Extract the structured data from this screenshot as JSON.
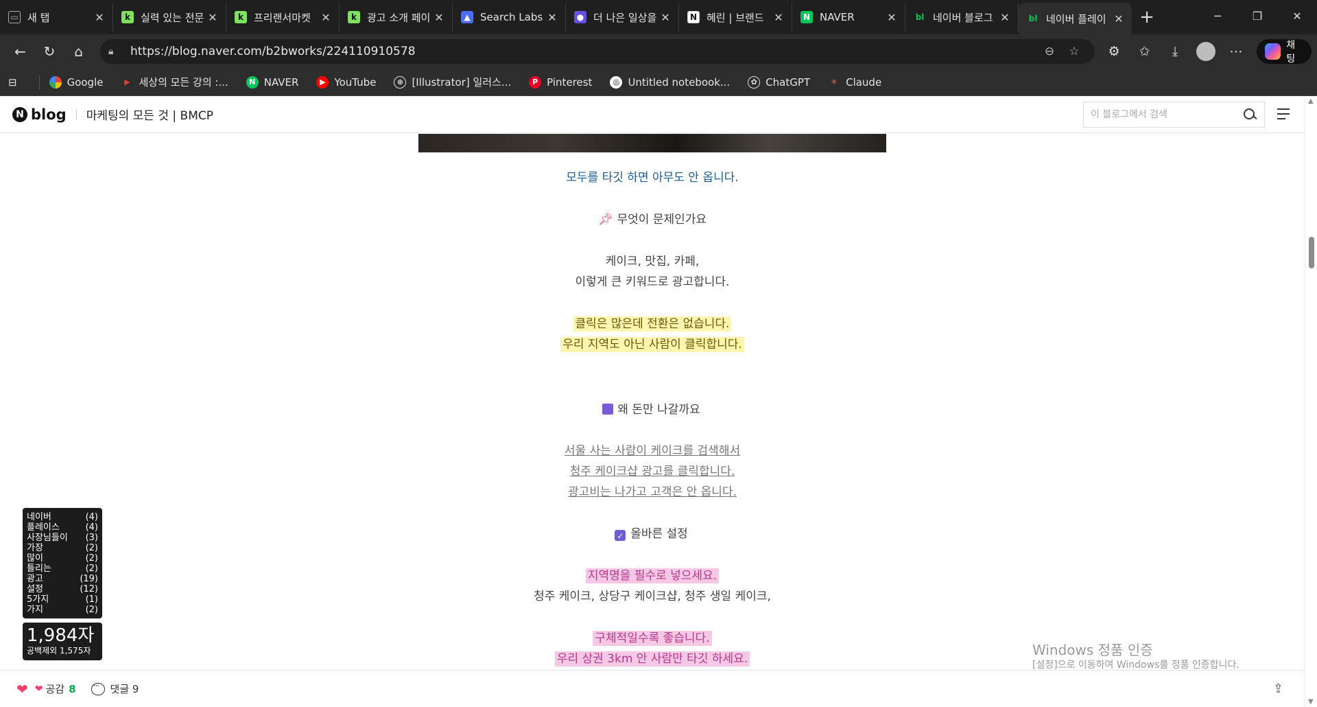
{
  "browser": {
    "tabs": [
      {
        "label": "새 탭",
        "icon": "new-tab-icon",
        "active": false
      },
      {
        "label": "실력 있는 전문",
        "icon": "kmong-icon",
        "active": false
      },
      {
        "label": "프리랜서마켓",
        "icon": "kmong-icon",
        "active": false
      },
      {
        "label": "광고 소개 페이",
        "icon": "kmong-icon",
        "active": false
      },
      {
        "label": "Search Labs",
        "icon": "search-labs-icon",
        "active": false
      },
      {
        "label": "더 나은 일상을",
        "icon": "circle-app-icon",
        "active": false
      },
      {
        "label": "혜린 | 브랜드",
        "icon": "notion-icon",
        "active": false
      },
      {
        "label": "NAVER",
        "icon": "naver-icon",
        "active": false
      },
      {
        "label": "네이버 블로그",
        "icon": "naver-blog-icon",
        "active": false
      },
      {
        "label": "네이버 플레이",
        "icon": "naver-blog-icon",
        "active": true
      }
    ],
    "url": "https://blog.naver.com/b2bworks/224110910578",
    "copilot_label": "채팅",
    "bookmarks": [
      {
        "label": "Google",
        "icon": "google-icon"
      },
      {
        "label": "세상의 모든 강의 :...",
        "icon": "play-icon"
      },
      {
        "label": "NAVER",
        "icon": "naver-icon"
      },
      {
        "label": "YouTube",
        "icon": "youtube-icon"
      },
      {
        "label": "[Illustrator] 일러스...",
        "icon": "globe-icon"
      },
      {
        "label": "Pinterest",
        "icon": "pinterest-icon"
      },
      {
        "label": "Untitled notebook...",
        "icon": "notebook-icon"
      },
      {
        "label": "ChatGPT",
        "icon": "chatgpt-icon"
      },
      {
        "label": "Claude",
        "icon": "claude-icon"
      }
    ]
  },
  "blog": {
    "logo": "blog",
    "logo_n": "N",
    "title": "마케팅의 모든 것 | BMCP",
    "search_placeholder": "이 블로그에서 검색"
  },
  "post": {
    "caption": "모두를 타깃 하면 아무도 안 옵니다.",
    "problem_heading": "무엇이 문제인가요",
    "problem_lines": [
      "케이크, 맛집, 카페,",
      "이렇게 큰 키워드로 광고합니다."
    ],
    "problem_highlight": [
      "클릭은 많은데 전환은 없습니다.",
      "우리 지역도 아닌 사람이 클릭합니다."
    ],
    "why_heading": "왜 돈만 나갈까요",
    "why_lines": [
      "서울 사는 사람이 케이크를 검색해서",
      "청주 케이크샵 광고를 클릭합니다.",
      "광고비는 나가고 고객은 안 옵니다."
    ],
    "setting_heading": "올바른 설정",
    "setting_highlight_1": "지역명을 필수로 넣으세요.",
    "setting_line": "청주 케이크, 상당구 케이크샵, 청주 생일 케이크,",
    "setting_highlight_2": [
      "구체적일수록 좋습니다.",
      "우리 상권 3km 안 사람만 타깃 하세요."
    ]
  },
  "keyword_panel": [
    {
      "word": "네이버",
      "count": "(4)"
    },
    {
      "word": "플레이스",
      "count": "(4)"
    },
    {
      "word": "사장님들이",
      "count": "(3)"
    },
    {
      "word": "가장",
      "count": "(2)"
    },
    {
      "word": "많이",
      "count": "(2)"
    },
    {
      "word": "틀리는",
      "count": "(2)"
    },
    {
      "word": "광고",
      "count": "(19)"
    },
    {
      "word": "설정",
      "count": "(12)"
    },
    {
      "word": "5가지",
      "count": "(1)"
    },
    {
      "word": "가지",
      "count": "(2)"
    }
  ],
  "char_count": {
    "total": "1,984자",
    "no_space": "공백제외 1,575자"
  },
  "watermark": {
    "title": "Windows 정품 인증",
    "subtitle": "[설정]으로 이동하여 Windows를 정품 인증합니다."
  },
  "actions": {
    "like_label": "공감",
    "like_count": "8",
    "comment_label": "댓글 9"
  }
}
